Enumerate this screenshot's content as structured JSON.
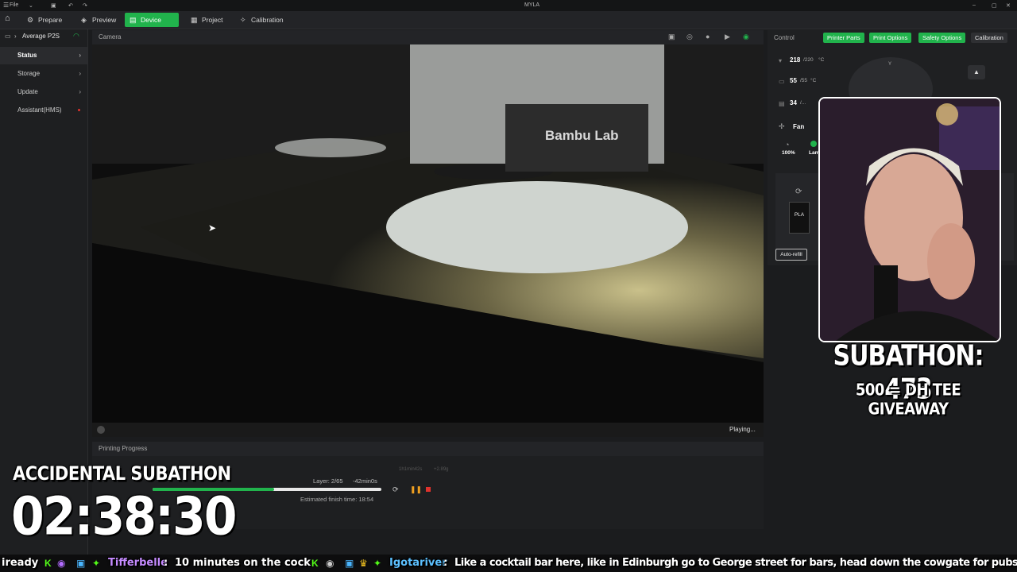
{
  "window": {
    "title": "MYLA",
    "file_menu": "File"
  },
  "tabs": [
    {
      "label": "Prepare",
      "icon": "prepare-icon"
    },
    {
      "label": "Preview",
      "icon": "preview-icon"
    },
    {
      "label": "Device",
      "icon": "device-icon",
      "active": true
    },
    {
      "label": "Project",
      "icon": "project-icon"
    },
    {
      "label": "Calibration",
      "icon": "calibration-icon"
    }
  ],
  "sidebar": {
    "printer_name": "Average P2S",
    "items": [
      {
        "label": "Status",
        "active": true
      },
      {
        "label": "Storage"
      },
      {
        "label": "Update"
      },
      {
        "label": "Assistant(HMS)",
        "alert": true
      }
    ]
  },
  "camera": {
    "title": "Camera",
    "status": "Playing..."
  },
  "progress": {
    "title": "Printing Progress",
    "layer": "Layer: 2/65",
    "remaining": "-42min0s",
    "estimated": "Estimated finish time: 18:54",
    "faint_time": "1h1min42s",
    "faint_weight": "+2.89g",
    "fraction": 0.53
  },
  "control": {
    "title": "Control",
    "buttons": [
      "Printer Parts",
      "Print Options",
      "Safety Options",
      "Calibration"
    ],
    "nozzle_temp": "218",
    "nozzle_target": "/220",
    "bed_temp": "55",
    "bed_target": "/55",
    "chamber_temp": "34",
    "chamber_target": "/...",
    "unit": "°C",
    "fan_label": "Fan",
    "speed": "100%",
    "lamp_label": "Lam",
    "filament": "PLA",
    "auto_refill": "Auto-refill"
  },
  "overlay": {
    "subathon_count": "SUBATHON: 473",
    "giveaway": "500 = DH TEE GIVEAWAY",
    "timer_title": "ACCIDENTAL SUBATHON",
    "timer": "02:38:30"
  },
  "chat": {
    "lead": "iready",
    "user1": "Tifferbelle",
    "msg1": "10 minutes on the cock",
    "user2": "Igotariver",
    "msg2": "Like a cocktail bar here, like in Edinburgh go to George street for bars, head down the cowgate for pubs"
  },
  "colors": {
    "accent": "#21b34c",
    "stop": "#e0322d",
    "pause": "#f0a020",
    "user1": "#b26cff",
    "user2": "#4ab6ff"
  }
}
